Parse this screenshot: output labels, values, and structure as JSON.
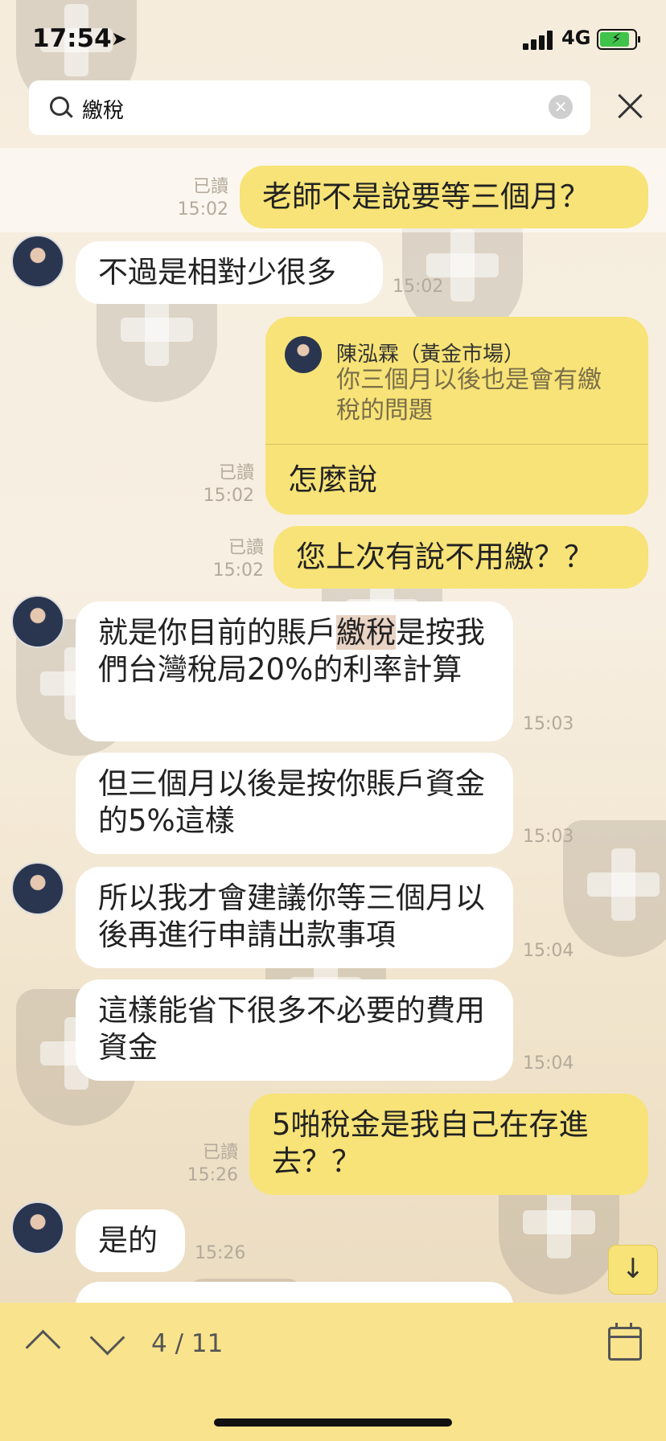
{
  "status_bar": {
    "time": "17:54",
    "network": "4G"
  },
  "search": {
    "query": "繳稅"
  },
  "messages": [
    {
      "id": "m1",
      "text": "老師不是說要等三個月？",
      "read": "已讀",
      "time": "15:02"
    },
    {
      "id": "m2",
      "text": "不過是相對少很多",
      "time": "15:02"
    },
    {
      "id": "m3",
      "reply_to_name": "陳泓霖（黃金市場）",
      "reply_to_text": "你三個月以後也是會有繳稅的問題",
      "text": "怎麼說",
      "read": "已讀",
      "time": "15:02"
    },
    {
      "id": "m4",
      "text": "您上次有說不用繳？？",
      "read": "已讀",
      "time": "15:02"
    },
    {
      "id": "m5",
      "text_before": "就是你目前的賬戶",
      "text_highlight": "繳稅",
      "text_after": "是按我們台灣稅局20%的利率計算",
      "time": "15:03"
    },
    {
      "id": "m6",
      "text": "但三個月以後是按你賬戶資金的5%這樣",
      "time": "15:03"
    },
    {
      "id": "m7",
      "text": "所以我才會建議你等三個月以後再進行申請出款事項",
      "time": "15:04"
    },
    {
      "id": "m8",
      "text": "這樣能省下很多不必要的費用資金",
      "time": "15:04"
    },
    {
      "id": "m9",
      "text": "5啪稅金是我自己在存進去？？",
      "read": "已讀",
      "time": "15:26"
    },
    {
      "id": "m10",
      "text": "是的",
      "time": "15:26"
    }
  ],
  "navigation": {
    "counter": "4 / 11"
  },
  "icons": {
    "search": "search-icon",
    "clear": "clear-icon",
    "close": "close-icon",
    "up": "chevron-up-icon",
    "down": "chevron-down-icon",
    "calendar": "calendar-icon",
    "scroll": "arrow-down-icon",
    "location": "location-arrow-icon"
  },
  "colors": {
    "outgoing_bubble": "#f7e377",
    "incoming_bubble": "#ffffff",
    "bottom_bar": "#f9e48d",
    "search_highlight": "#e8d3c4"
  }
}
